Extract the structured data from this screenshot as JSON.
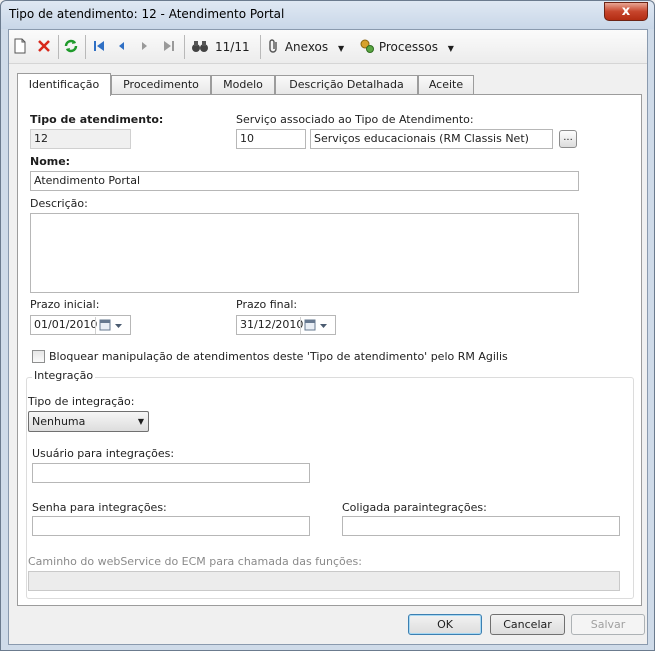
{
  "window": {
    "title": "Tipo de atendimento: 12 - Atendimento Portal",
    "close_label": "x"
  },
  "toolbar": {
    "record_position": "11/11",
    "attachments_label": "Anexos",
    "processes_label": "Processos"
  },
  "tabs": [
    {
      "label": "Identificação"
    },
    {
      "label": "Procedimento"
    },
    {
      "label": "Modelo"
    },
    {
      "label": "Descrição Detalhada"
    },
    {
      "label": "Aceite"
    }
  ],
  "form": {
    "tipo_label": "Tipo de atendimento:",
    "tipo_value": "12",
    "servico_label": "Serviço associado ao Tipo de Atendimento:",
    "servico_code": "10",
    "servico_name": "Serviços educacionais (RM Classis Net)",
    "lookup_label": "...",
    "nome_label": "Nome:",
    "nome_value": "Atendimento Portal",
    "descricao_label": "Descrição:",
    "descricao_value": "",
    "prazo_inicial_label": "Prazo inicial:",
    "prazo_inicial_value": "01/01/2010",
    "prazo_final_label": "Prazo final:",
    "prazo_final_value": "31/12/2010",
    "bloquear_label": "Bloquear manipulação de atendimentos deste 'Tipo de atendimento' pelo RM Agilis",
    "bloquear_checked": false
  },
  "integracao": {
    "group_title": "Integração",
    "tipo_label": "Tipo de integração:",
    "tipo_value": "Nenhuma",
    "usuario_label": "Usuário para integrações:",
    "usuario_value": "",
    "senha_label": "Senha para integrações:",
    "senha_value": "",
    "coligada_label": "Coligada paraintegrações:",
    "coligada_value": "",
    "caminho_label": "Caminho do webService do ECM para chamada das funções:",
    "caminho_value": ""
  },
  "buttons": {
    "ok": "OK",
    "cancel": "Cancelar",
    "save": "Salvar"
  }
}
